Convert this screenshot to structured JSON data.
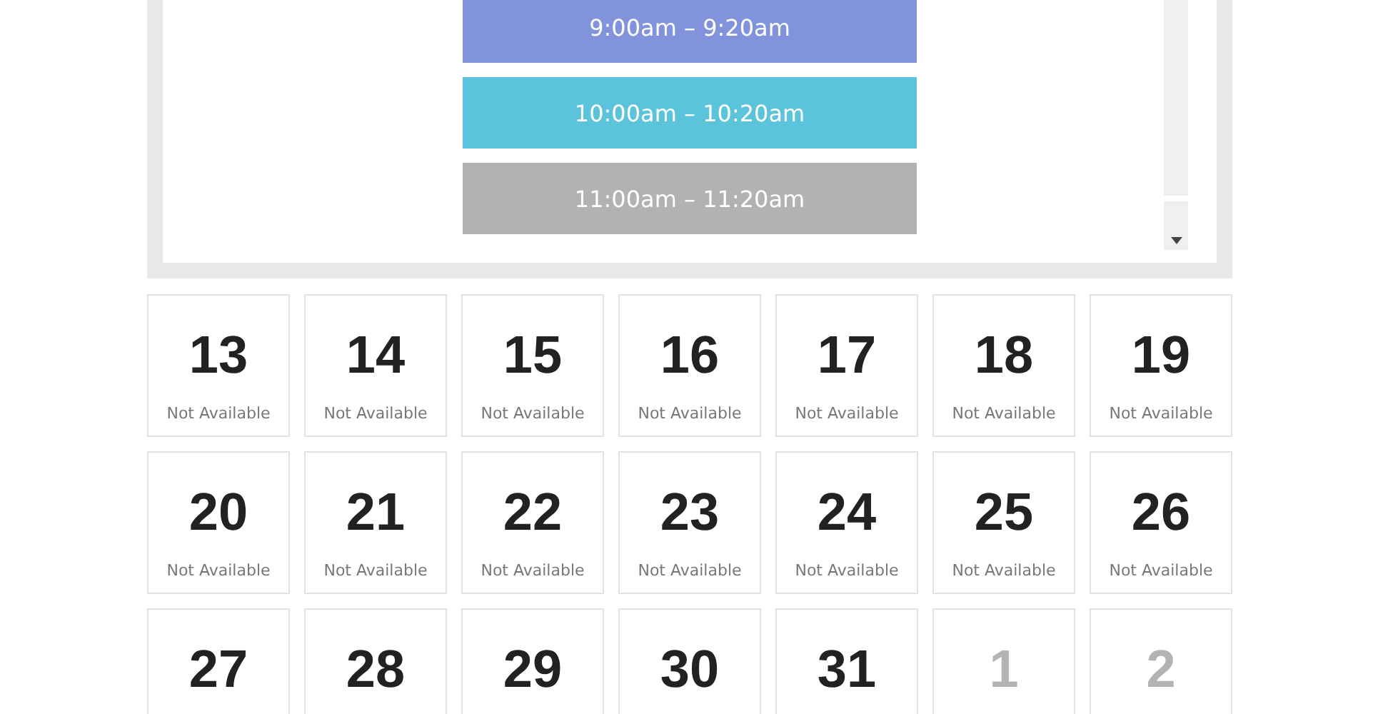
{
  "time_slots": [
    {
      "label": "9:00am – 9:20am",
      "color": "#8194db"
    },
    {
      "label": "10:00am – 10:20am",
      "color": "#5bc4db"
    },
    {
      "label": "11:00am – 11:20am",
      "color": "#b2b2b2"
    }
  ],
  "days": [
    {
      "day": "13",
      "status": "Not Available",
      "other_month": false
    },
    {
      "day": "14",
      "status": "Not Available",
      "other_month": false
    },
    {
      "day": "15",
      "status": "Not Available",
      "other_month": false
    },
    {
      "day": "16",
      "status": "Not Available",
      "other_month": false
    },
    {
      "day": "17",
      "status": "Not Available",
      "other_month": false
    },
    {
      "day": "18",
      "status": "Not Available",
      "other_month": false
    },
    {
      "day": "19",
      "status": "Not Available",
      "other_month": false
    },
    {
      "day": "20",
      "status": "Not Available",
      "other_month": false
    },
    {
      "day": "21",
      "status": "Not Available",
      "other_month": false
    },
    {
      "day": "22",
      "status": "Not Available",
      "other_month": false
    },
    {
      "day": "23",
      "status": "Not Available",
      "other_month": false
    },
    {
      "day": "24",
      "status": "Not Available",
      "other_month": false
    },
    {
      "day": "25",
      "status": "Not Available",
      "other_month": false
    },
    {
      "day": "26",
      "status": "Not Available",
      "other_month": false
    },
    {
      "day": "27",
      "other_month": false
    },
    {
      "day": "28",
      "other_month": false
    },
    {
      "day": "29",
      "other_month": false
    },
    {
      "day": "30",
      "other_month": false
    },
    {
      "day": "31",
      "other_month": false
    },
    {
      "day": "1",
      "other_month": true
    },
    {
      "day": "2",
      "other_month": true
    }
  ]
}
